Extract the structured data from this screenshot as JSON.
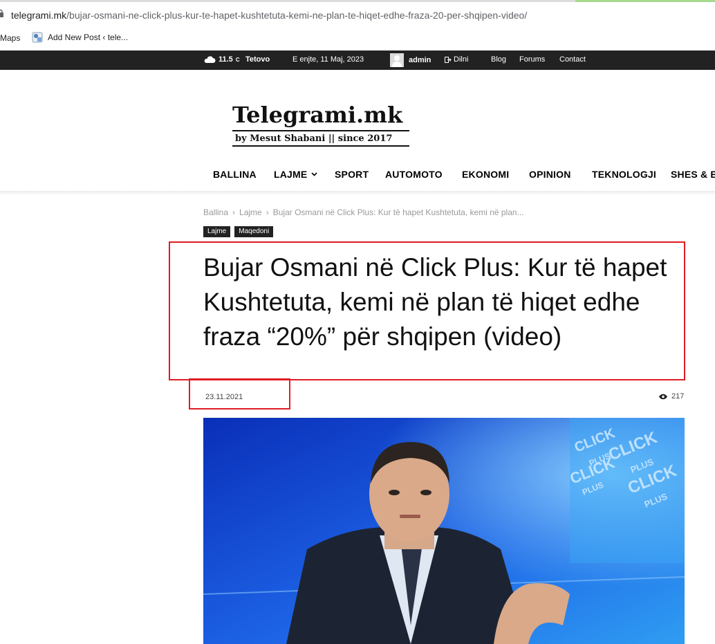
{
  "browser": {
    "url_host": "telegrami.mk",
    "url_path": "/bujar-osmani-ne-click-plus-kur-te-hapet-kushtetuta-kemi-ne-plan-te-hiqet-edhe-fraza-20-per-shqipen-video/",
    "bookmarks": [
      "Maps",
      "Add New Post ‹ tele..."
    ]
  },
  "topbar": {
    "temperature": "11.5",
    "unit": "C",
    "city": "Tetovo",
    "date": "E enjte, 11 Maj, 2023",
    "user": "admin",
    "logout": "Dilni",
    "links": [
      "Blog",
      "Forums",
      "Contact"
    ]
  },
  "logo": {
    "title": "Telegrami.mk",
    "subtitle": "by Mesut Shabani || since 2017"
  },
  "nav": [
    "BALLINA",
    "LAJME",
    "SPORT",
    "AUTOMOTO",
    "EKONOMI",
    "OPINION",
    "TEKNOLOGJI",
    "SHES & BL"
  ],
  "breadcrumb": [
    "Ballina",
    "Lajme",
    "Bujar Osmani në Click Plus: Kur të hapet Kushtetuta, kemi në plan..."
  ],
  "tags": [
    "Lajme",
    "Maqedoni"
  ],
  "article": {
    "title": "Bujar Osmani në Click Plus: Kur të hapet Kushtetuta, kemi në plan të hiqet edhe fraza “20%” për shqipen (video)",
    "date": "23.11.2021",
    "views": "217"
  },
  "hero_logo_text": [
    "CLICK",
    "PLUS"
  ],
  "colors": {
    "highlight": "#e01b24",
    "topbar": "#222222"
  }
}
